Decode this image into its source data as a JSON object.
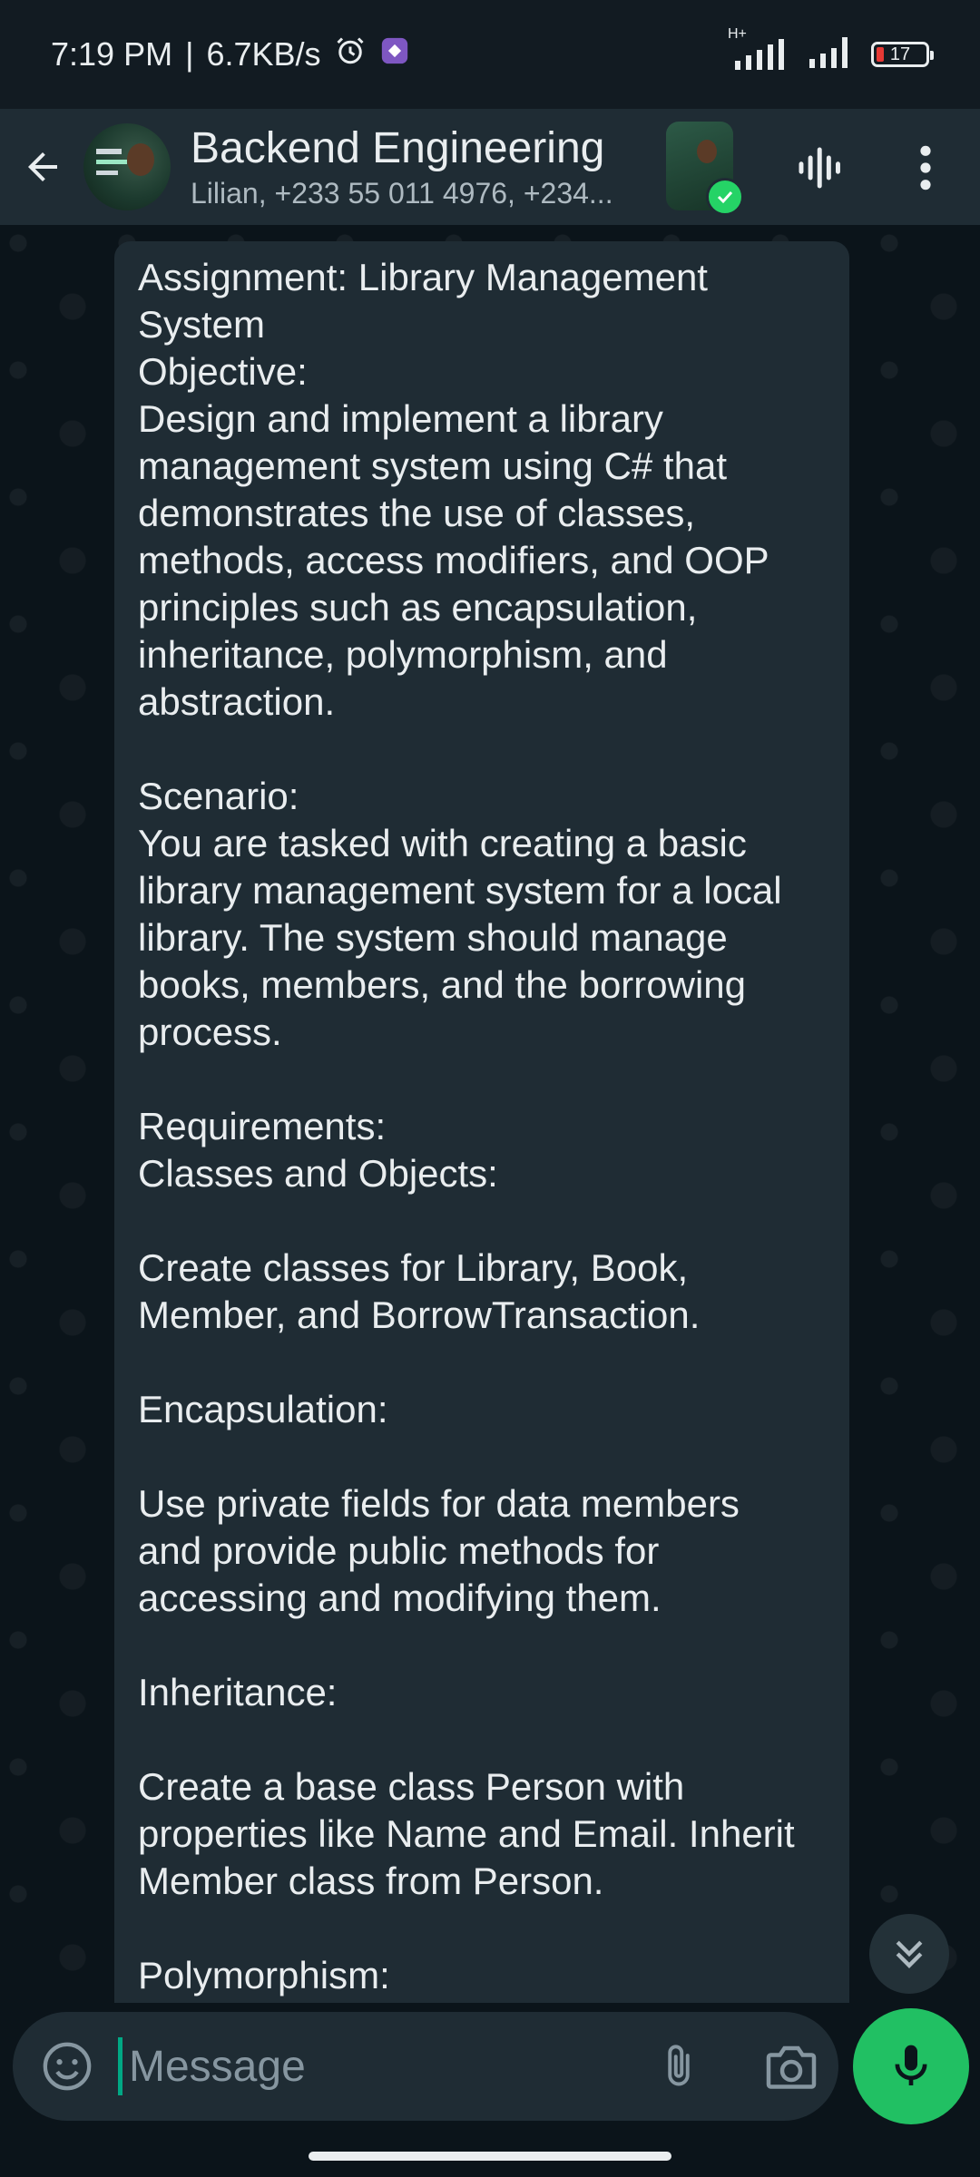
{
  "status_bar": {
    "time": "7:19 PM",
    "separator": "|",
    "net_speed": "6.7KB/s",
    "network_type": "H+",
    "battery_level": "17",
    "icons": [
      "alarm-icon",
      "app-notification-icon",
      "signal-icon",
      "battery-icon"
    ]
  },
  "header": {
    "title": "Backend Engineering",
    "subtitle": "Lilian, +233 55 011 4976, +234...",
    "icons": [
      "back-arrow-icon",
      "group-avatar",
      "status-thumbnail",
      "voice-chat-icon",
      "more-vert-icon"
    ]
  },
  "message": {
    "text": "Assignment: Library Management\nSystem\nObjective:\nDesign and implement a library\nmanagement system using C# that\ndemonstrates the use of classes,\nmethods, access modifiers, and OOP\nprinciples such as encapsulation,\ninheritance, polymorphism, and\nabstraction.\n\nScenario:\nYou are tasked with creating a basic\nlibrary management system for a local\nlibrary. The system should manage\nbooks, members, and the borrowing\nprocess.\n\nRequirements:\nClasses and Objects:\n\nCreate classes for Library, Book,\nMember, and BorrowTransaction.\n\nEncapsulation:\n\nUse private fields for data members\nand provide public methods for\naccessing and modifying them.\n\nInheritance:\n\nCreate a base class Person with\nproperties like Name and Email. Inherit\nMember class from Person.\n\nPolymorphism:"
  },
  "composer": {
    "placeholder": "Message",
    "value": ""
  },
  "colors": {
    "background": "#0b141a",
    "bar": "#1f2c34",
    "accent": "#21c063",
    "text": "#e9edef",
    "muted": "#8696a0"
  }
}
